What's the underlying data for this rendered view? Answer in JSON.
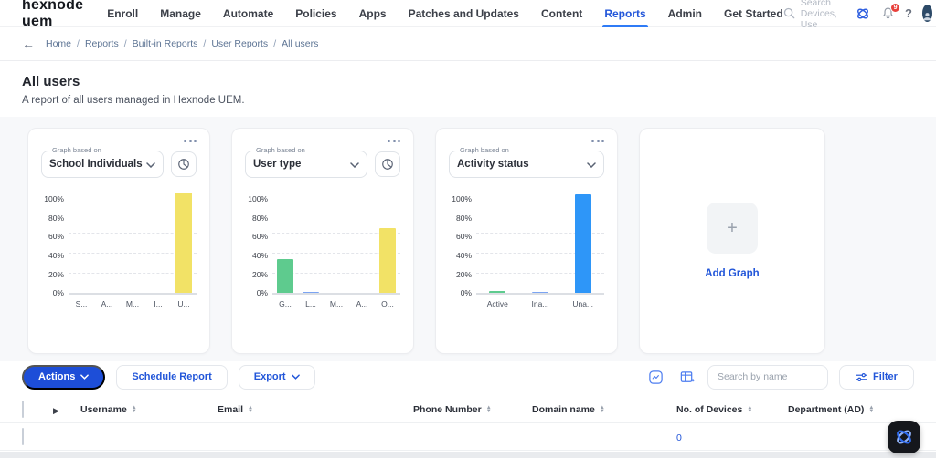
{
  "nav": {
    "logo": "hexnode uem",
    "items": [
      {
        "label": "Enroll"
      },
      {
        "label": "Manage"
      },
      {
        "label": "Automate"
      },
      {
        "label": "Policies"
      },
      {
        "label": "Apps"
      },
      {
        "label": "Patches and Updates"
      },
      {
        "label": "Content"
      },
      {
        "label": "Reports"
      },
      {
        "label": "Admin"
      },
      {
        "label": "Get Started"
      }
    ],
    "active_item": "Reports",
    "search_placeholder": "Search Devices, Use",
    "notification_count": "9"
  },
  "breadcrumb": {
    "separator": "/",
    "items": [
      "Home",
      "Reports",
      "Built-in Reports",
      "User Reports",
      "All users"
    ]
  },
  "page": {
    "title": "All users",
    "subtitle": "A report of all users managed in Hexnode UEM."
  },
  "cards": {
    "graph_based_on_label": "Graph based on",
    "add_graph_label": "Add Graph"
  },
  "chart_data": [
    {
      "type": "bar",
      "title": "School Individuals",
      "categories": [
        "S...",
        "A...",
        "M...",
        "I...",
        "U..."
      ],
      "values": [
        0,
        0,
        0,
        0,
        100
      ],
      "bar_colors": [
        "#f2e266",
        "#f2e266",
        "#f2e266",
        "#f2e266",
        "#f2e266"
      ],
      "ylim": [
        0,
        100
      ],
      "ytick_labels": [
        "100%",
        "80%",
        "60%",
        "40%",
        "20%",
        "0%"
      ],
      "grid": "dashed-horizontal"
    },
    {
      "type": "bar",
      "title": "User type",
      "categories": [
        "G...",
        "L...",
        "M...",
        "A...",
        "O..."
      ],
      "values": [
        34,
        1,
        0,
        0,
        65
      ],
      "bar_colors": [
        "#5ecb8e",
        "#7ba4f2",
        "#5ecb8e",
        "#5ecb8e",
        "#f2e266"
      ],
      "ylim": [
        0,
        100
      ],
      "ytick_labels": [
        "100%",
        "80%",
        "60%",
        "40%",
        "20%",
        "0%"
      ],
      "grid": "dashed-horizontal"
    },
    {
      "type": "bar",
      "title": "Activity status",
      "categories": [
        "Active",
        "Ina...",
        "Una..."
      ],
      "values": [
        1.5,
        0.7,
        98
      ],
      "bar_colors": [
        "#5ecb8e",
        "#7ba4f2",
        "#2e96f8"
      ],
      "ylim": [
        0,
        100
      ],
      "ytick_labels": [
        "100%",
        "80%",
        "60%",
        "40%",
        "20%",
        "0%"
      ],
      "grid": "dashed-horizontal"
    }
  ],
  "toolbar": {
    "actions_label": "Actions",
    "schedule_label": "Schedule Report",
    "export_label": "Export",
    "search_placeholder": "Search by name",
    "filter_label": "Filter"
  },
  "table": {
    "columns": [
      "Username",
      "Email",
      "Phone Number",
      "Domain name",
      "No. of Devices",
      "Department (AD)"
    ],
    "rows": [
      {
        "no_of_devices": "0"
      }
    ]
  },
  "colors": {
    "primary_blue": "#2256d9",
    "button_blue": "#1d4ed8",
    "active_tab_underline": "#2f7bf6",
    "bar_yellow": "#f2e266",
    "bar_green": "#5ecb8e",
    "bar_blue": "#2e96f8",
    "bar_lightblue": "#7ba4f2",
    "notification_red": "#e8413c",
    "section_gray": "#f7f8fa"
  }
}
